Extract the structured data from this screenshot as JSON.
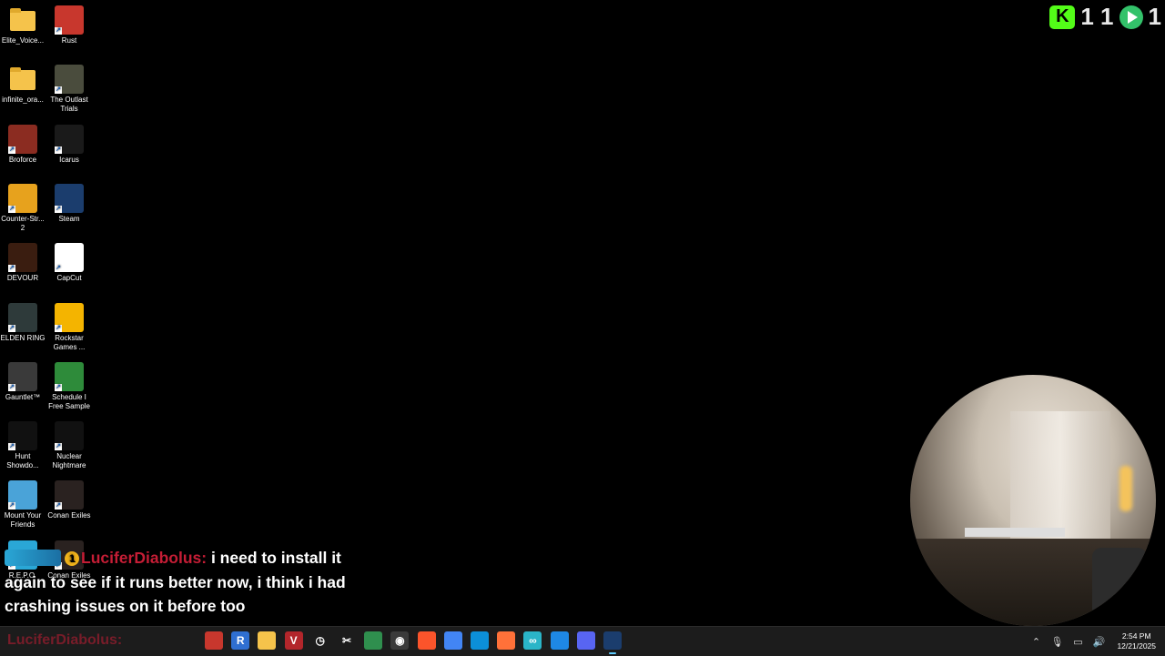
{
  "desktop_icons": [
    {
      "label": "Elite_Voice...",
      "icon": "folder-icon",
      "color": "#f5c34b",
      "shortcut": false
    },
    {
      "label": "Rust",
      "icon": "rust-icon",
      "color": "#c8372d",
      "shortcut": true
    },
    {
      "label": "infinite_ora...",
      "icon": "folder-icon",
      "color": "#f5c34b",
      "shortcut": false
    },
    {
      "label": "The Outlast Trials",
      "icon": "outlast-trials-icon",
      "color": "#4a4c3d",
      "shortcut": true
    },
    {
      "label": "Broforce",
      "icon": "broforce-icon",
      "color": "#8b2c21",
      "shortcut": true
    },
    {
      "label": "Icarus",
      "icon": "icarus-icon",
      "color": "#1a1a1a",
      "shortcut": true
    },
    {
      "label": "Counter-Str... 2",
      "icon": "counter-strike-icon",
      "color": "#e7a21d",
      "shortcut": true
    },
    {
      "label": "Steam",
      "icon": "steam-icon",
      "color": "#1b3d6d",
      "shortcut": true
    },
    {
      "label": "DEVOUR",
      "icon": "devour-icon",
      "color": "#3a1d10",
      "shortcut": true
    },
    {
      "label": "CapCut",
      "icon": "capcut-icon",
      "color": "#ffffff",
      "shortcut": true
    },
    {
      "label": "ELDEN RING",
      "icon": "elden-ring-icon",
      "color": "#2e3a3a",
      "shortcut": true
    },
    {
      "label": "Rockstar Games ...",
      "icon": "rockstar-icon",
      "color": "#f4b400",
      "shortcut": true
    },
    {
      "label": "Gauntlet™",
      "icon": "gauntlet-icon",
      "color": "#3a3a3a",
      "shortcut": true
    },
    {
      "label": "Schedule I Free Sample",
      "icon": "schedule-i-icon",
      "color": "#2e8b3a",
      "shortcut": true
    },
    {
      "label": "Hunt Showdo...",
      "icon": "hunt-showdown-icon",
      "color": "#111111",
      "shortcut": true
    },
    {
      "label": "Nuclear Nightmare",
      "icon": "nuclear-nightmare-icon",
      "color": "#111111",
      "shortcut": true
    },
    {
      "label": "Mount Your Friends",
      "icon": "mount-your-friends-icon",
      "color": "#4aa3d8",
      "shortcut": true
    },
    {
      "label": "Conan Exiles",
      "icon": "conan-exiles-icon",
      "color": "#2a2220",
      "shortcut": true
    },
    {
      "label": "R.E.P.O.",
      "icon": "repo-icon",
      "color": "#2aa7d6",
      "shortcut": true
    },
    {
      "label": "Conan Exiles",
      "icon": "conan-exiles-icon",
      "color": "#2a2220",
      "shortcut": true
    }
  ],
  "overlay": {
    "counter_kick": "1 1",
    "counter_rumble": "1"
  },
  "chat": {
    "badge_number": "1",
    "username": "LuciferDiabolus:",
    "message": "i need to install it again to see if it runs better now, i think i had crashing issues on it before too"
  },
  "taskbar": {
    "ghost_username": "LuciferDiabolus:",
    "pinned": [
      {
        "icon": "app-red-icon",
        "color": "#c8372d"
      },
      {
        "icon": "r-app-icon",
        "color": "#2f6fd1",
        "glyph": "R"
      },
      {
        "icon": "file-explorer-icon",
        "color": "#f5c34b"
      },
      {
        "icon": "voicemeeter-icon",
        "color": "#b3262b",
        "glyph": "V"
      },
      {
        "icon": "stopwatch-icon",
        "color": "#1c1c1c",
        "glyph": "◷"
      },
      {
        "icon": "capcut-icon",
        "color": "#1c1c1c",
        "glyph": "✂"
      },
      {
        "icon": "map-app-icon",
        "color": "#2f8f4e"
      },
      {
        "icon": "obs-icon",
        "color": "#3a3a3a",
        "glyph": "◉"
      },
      {
        "icon": "brave-icon",
        "color": "#fb542b"
      },
      {
        "icon": "chrome-icon",
        "color": "#4285f4"
      },
      {
        "icon": "edge-icon",
        "color": "#0c8fd8"
      },
      {
        "icon": "firefox-icon",
        "color": "#ff7139"
      },
      {
        "icon": "app-teal-icon",
        "color": "#2ab5c8",
        "glyph": "∞"
      },
      {
        "icon": "vscode-icon",
        "color": "#1e88e5"
      },
      {
        "icon": "discord-icon",
        "color": "#5865f2"
      },
      {
        "icon": "steam-icon",
        "color": "#1b3d6d",
        "active": true
      }
    ],
    "clock_time": "2:54 PM",
    "clock_date": "12/21/2025"
  }
}
